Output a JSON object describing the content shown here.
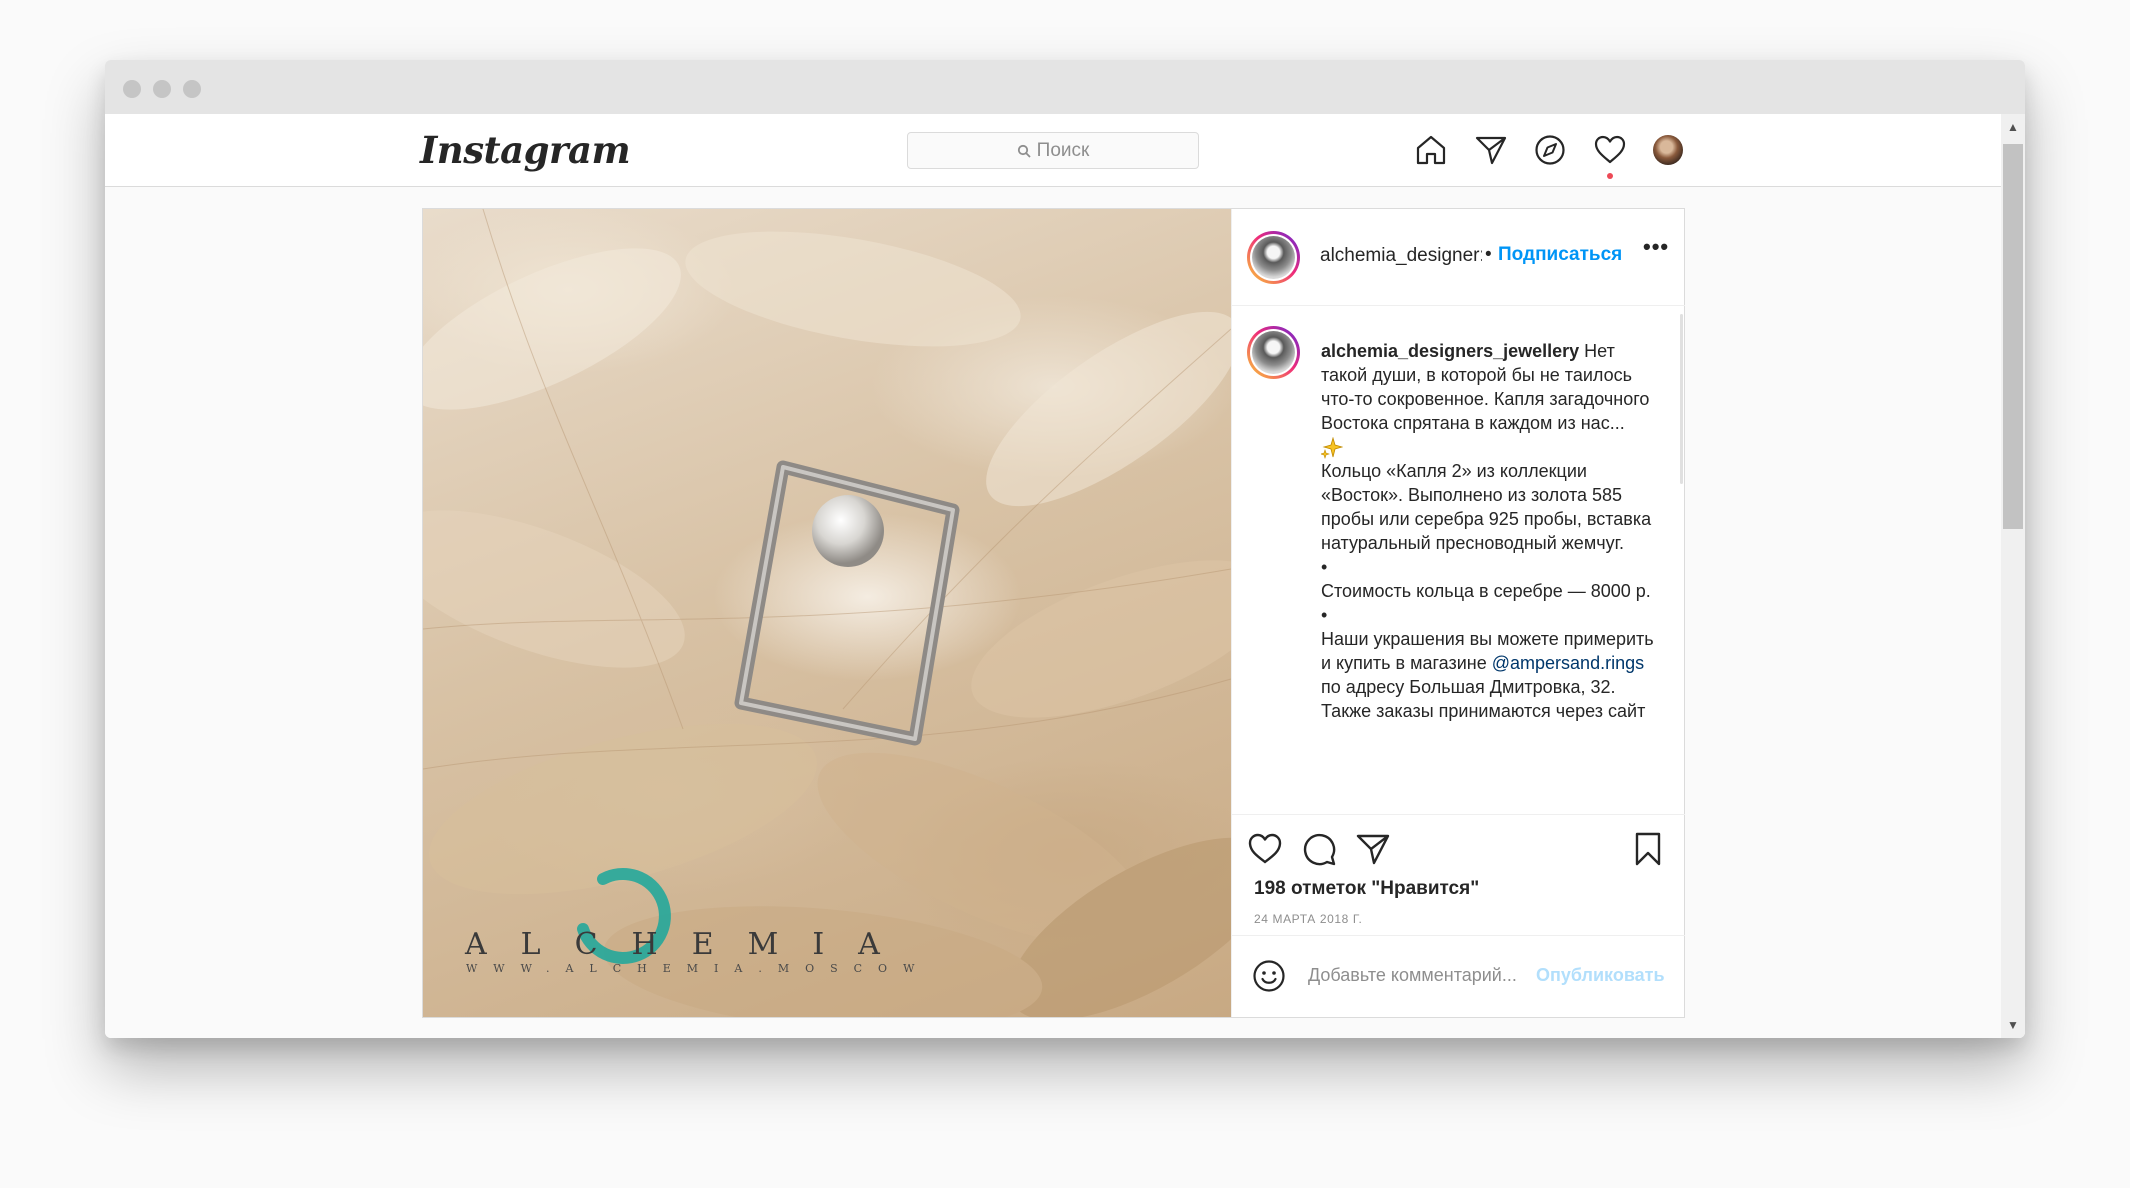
{
  "header": {
    "logo": "Instagram",
    "search_placeholder": "Поиск"
  },
  "post": {
    "username_short": "alchemia_designer:",
    "separator": "•",
    "follow_label": "Подписаться",
    "more_label": "•••",
    "caption": {
      "username": "alchemia_designers_jewellery",
      "intro": " Нет такой души, в которой бы не таилось что-то сокровенное. Капля загадочного Востока спрятана в каждом из нас...",
      "paragraph_1": "Кольцо «Капля 2» из коллекции «Восток». Выполнено из золота 585 пробы или серебра 925 пробы, вставка натуральный пресноводный жемчуг.",
      "bullet": "•",
      "paragraph_2": "Стоимость кольца в серебре — 8000 р.",
      "paragraph_3_start": "Наши украшения вы можете примерить и купить в магазине ",
      "mention": "@ampersand.rings",
      "paragraph_3_end": " по адресу Большая Дмитровка, 32. Также заказы принимаются через сайт"
    },
    "likes": "198 отметок \"Нравится\"",
    "date": "24 МАРТА 2018 Г.",
    "comment_placeholder": "Добавьте комментарий...",
    "publish_label": "Опубликовать",
    "watermark_main": "ALCHEMIA",
    "watermark_sub": "WWW.ALCHEMIA.MOSCOW"
  },
  "scrollbar": {
    "up": "▲",
    "down": "▼"
  },
  "colors": {
    "link_blue": "#0095f6",
    "publish_disabled": "#b2dffc",
    "notification_red": "#ed4956",
    "mention": "#00376b"
  }
}
